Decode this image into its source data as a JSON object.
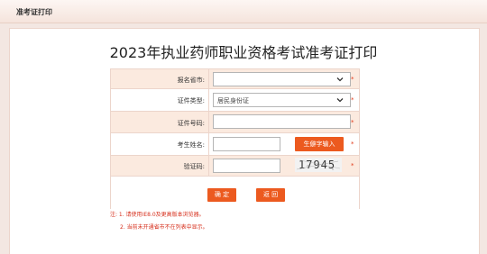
{
  "titlebar": {
    "label": "准考证打印"
  },
  "heading": "2023年执业药师职业资格考试准考证打印",
  "fields": {
    "province": {
      "label": "报名省市:",
      "value": "",
      "required": "*"
    },
    "id_type": {
      "label": "证件类型:",
      "value": "居民身份证",
      "required": "*"
    },
    "id_number": {
      "label": "证件号码:",
      "value": "",
      "required": "*"
    },
    "name": {
      "label": "考生姓名:",
      "value": "",
      "rare_char_button": "生僻字输入",
      "required": "*"
    },
    "captcha": {
      "label": "验证码:",
      "value": "",
      "code": "17945",
      "required": "*"
    }
  },
  "buttons": {
    "confirm": "确 定",
    "back": "返 回"
  },
  "notes": {
    "line1": "注: 1. 请使用IE8.0及更高版本浏览器。",
    "line2": "2. 当前未开通省市不在列表中显示。"
  },
  "colors": {
    "accent": "#ec5a1f",
    "required": "#e13b1b",
    "row_tint": "#fbeadf"
  },
  "icons": {
    "select_arrow": "chevron-down-icon"
  }
}
